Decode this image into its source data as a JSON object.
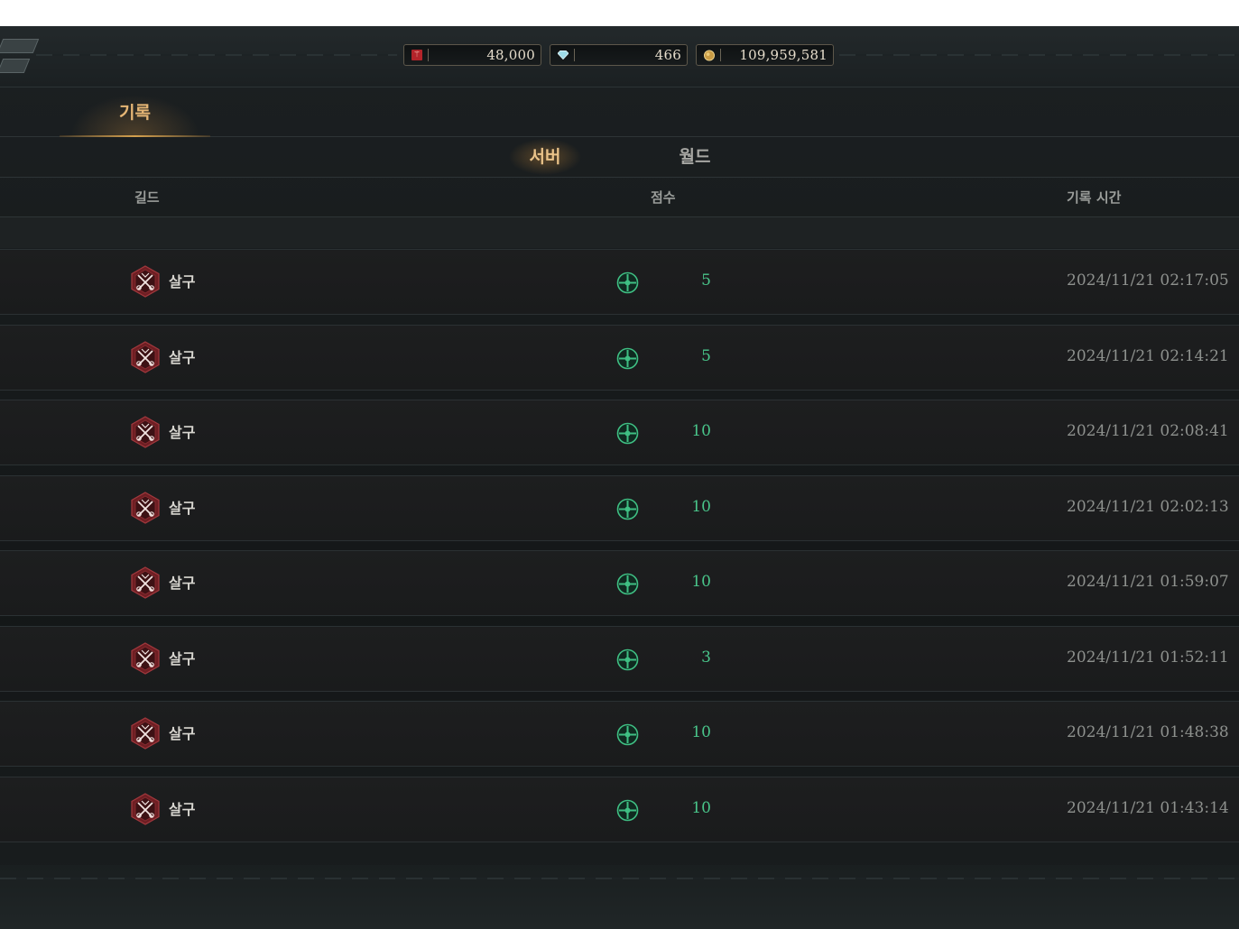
{
  "currencies": [
    {
      "icon": "red-crystal-icon",
      "value": "48,000"
    },
    {
      "icon": "blue-gem-icon",
      "value": "466"
    },
    {
      "icon": "gold-coin-icon",
      "value": "109,959,581"
    }
  ],
  "main_tab": {
    "label": "기록"
  },
  "sub_tabs": {
    "server": "서버",
    "world": "월드"
  },
  "columns": {
    "guild": "길드",
    "score": "점수",
    "record_time": "기록 시간"
  },
  "rows": [
    {
      "guild": "살구",
      "score": "5",
      "time": "2024/11/21 02:17:05"
    },
    {
      "guild": "살구",
      "score": "5",
      "time": "2024/11/21 02:14:21"
    },
    {
      "guild": "살구",
      "score": "10",
      "time": "2024/11/21 02:08:41"
    },
    {
      "guild": "살구",
      "score": "10",
      "time": "2024/11/21 02:02:13"
    },
    {
      "guild": "살구",
      "score": "10",
      "time": "2024/11/21 01:59:07"
    },
    {
      "guild": "살구",
      "score": "3",
      "time": "2024/11/21 01:52:11"
    },
    {
      "guild": "살구",
      "score": "10",
      "time": "2024/11/21 01:48:38"
    },
    {
      "guild": "살구",
      "score": "10",
      "time": "2024/11/21 01:43:14"
    }
  ],
  "colors": {
    "accent_gold": "#e6b675",
    "score_green": "#49c58a",
    "emblem_red": "#7a2226"
  }
}
